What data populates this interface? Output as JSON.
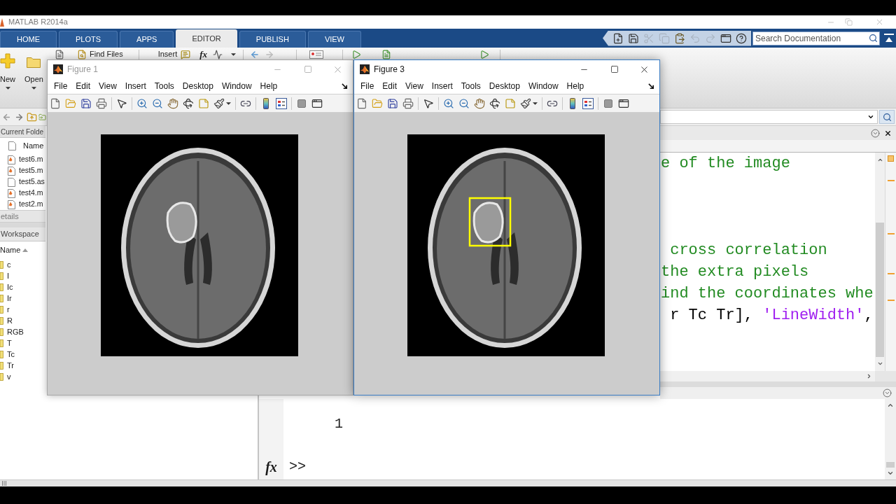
{
  "window": {
    "title": "MATLAB R2014a"
  },
  "tabs": [
    {
      "label": "HOME",
      "selected": false
    },
    {
      "label": "PLOTS",
      "selected": false
    },
    {
      "label": "APPS",
      "selected": false
    },
    {
      "label": "EDITOR",
      "selected": true
    },
    {
      "label": "PUBLISH",
      "selected": false
    },
    {
      "label": "VIEW",
      "selected": false
    }
  ],
  "search": {
    "placeholder": "Search Documentation"
  },
  "ribbon": {
    "new": "New",
    "open": "Open",
    "find_files": "Find Files",
    "insert": "Insert",
    "function": "fx"
  },
  "current_folder": {
    "title": "Current Folde",
    "column": "Name",
    "files": [
      {
        "name": "test6.m",
        "kind": "script"
      },
      {
        "name": "test5.m",
        "kind": "script"
      },
      {
        "name": "test5.as",
        "kind": "plain"
      },
      {
        "name": "test4.m",
        "kind": "script"
      },
      {
        "name": "test2.m",
        "kind": "script"
      }
    ]
  },
  "details": {
    "title": "etails"
  },
  "workspace": {
    "title": "Workspace",
    "column": "Name",
    "variables": [
      "c",
      "I",
      "Ic",
      "Ir",
      "r",
      "R",
      "RGB",
      "T",
      "Tc",
      "Tr",
      "v"
    ]
  },
  "editor": {
    "blocks": [
      {
        "lines": [
          [
            {
              "text": "e of the image",
              "kind": "comment"
            }
          ]
        ]
      },
      {
        "lines": [
          [
            {
              "text": " cross correlation",
              "kind": "comment"
            }
          ],
          [
            {
              "text": "the extra pixels",
              "kind": "comment"
            }
          ],
          [
            {
              "text": "ind the coordinates whe",
              "kind": "comment"
            }
          ],
          [
            {
              "text": " r Tc Tr], ",
              "kind": "code"
            },
            {
              "text": "'LineWidth'",
              "kind": "string"
            },
            {
              "text": ",",
              "kind": "code"
            }
          ]
        ]
      }
    ]
  },
  "command_window": {
    "output": "1",
    "function_button": "fx",
    "prompt": ">>"
  },
  "figures": [
    {
      "title": "Figure 1",
      "active": false,
      "menus": [
        "File",
        "Edit",
        "View",
        "Insert",
        "Tools",
        "Desktop",
        "Window",
        "Help"
      ],
      "highlight_box": false
    },
    {
      "title": "Figure 3",
      "active": true,
      "menus": [
        "File",
        "Edit",
        "View",
        "Insert",
        "Tools",
        "Desktop",
        "Window",
        "Help"
      ],
      "highlight_box": true
    }
  ]
}
